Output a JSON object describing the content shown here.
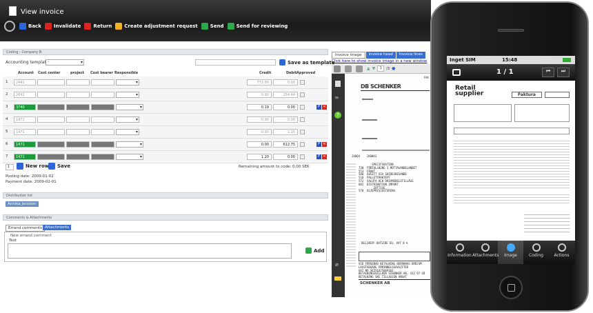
{
  "header": {
    "title": "View invoice",
    "toolbar": [
      {
        "label": "Back",
        "icon": "back-icon",
        "color": "#2a66d8"
      },
      {
        "label": "Invalidate",
        "icon": "invalidate-icon",
        "color": "#d22"
      },
      {
        "label": "Return",
        "icon": "return-icon",
        "color": "#d22"
      },
      {
        "label": "Create adjustment request",
        "icon": "folder-icon",
        "color": "#f0b020"
      },
      {
        "label": "Send",
        "icon": "check-icon",
        "color": "#2aa84a"
      },
      {
        "label": "Send for reviewing",
        "icon": "check-icon",
        "color": "#2aa84a"
      }
    ]
  },
  "coding": {
    "section_title": "Coding - Company B",
    "templates_label": "Accounting templates",
    "templates_value": "-",
    "save_template": "Save as template",
    "columns": [
      "Account",
      "Cost center",
      "project",
      "Cost bearer",
      "Responsible",
      "Credit",
      "Debit",
      "Approved"
    ],
    "rows": [
      {
        "n": "1",
        "account": "2441",
        "credit": "772.00",
        "debit": "0.00",
        "active": false,
        "green": false
      },
      {
        "n": "2",
        "account": "2641",
        "credit": "0.00",
        "debit": "154.44",
        "active": false,
        "green": false
      },
      {
        "n": "3",
        "account": "3740",
        "credit": "0.19",
        "debit": "0.00",
        "active": true,
        "green": true
      },
      {
        "n": "4",
        "account": "1471",
        "credit": "0.00",
        "debit": "0.00",
        "active": false,
        "green": false
      },
      {
        "n": "5",
        "account": "1471",
        "credit": "0.00",
        "debit": "1.25",
        "active": false,
        "green": false
      },
      {
        "n": "6",
        "account": "1471",
        "credit": "0.00",
        "debit": "612.75",
        "active": true,
        "green": true
      },
      {
        "n": "7",
        "account": "1471",
        "credit": "1.20",
        "debit": "0.00",
        "active": true,
        "green": true
      }
    ],
    "new_row_count": "1",
    "new_row": "New row",
    "save": "Save",
    "remaining": "Remaining amount to code:  0.00 SEK",
    "posting_date": "Posting date: 2009-01-02",
    "payment_date": "Payment date: 2009-02-01"
  },
  "distribution": {
    "title": "Distribution list",
    "person": "Annika Jansson"
  },
  "comments": {
    "title": "Comments & Attachments",
    "tab_comments": "Errand comments",
    "tab_attachments": "Attachments",
    "legend": "New errand comment",
    "text_label": "Text",
    "add": "Add"
  },
  "viewer": {
    "tabs": [
      "Invoice image",
      "Invoice head",
      "Invoice lines"
    ],
    "link": "Click here to show invoice image in a new window",
    "page": "1",
    "pages": "/3",
    "company": "DB SCHENKER",
    "footer_company": "SCHENKER AB",
    "page_label": "FAK",
    "codes": "JX064    JX0043",
    "body": "        SPECIFIKATION\n730  FÖRTULLNING I MOTTAGANDELANDET\n553  FRAKT\n580  AVGIFT VIA SKIDESRESANDE\n510  PALLETFRAKTEPT\n572  VALUTA OCH DRIVMEDELSTILLÄGG\n602  DISTRIBUTION IMPORT\n         ZOTTIGE\n570  OLJEPRISJUSTERING",
    "delivery": "DELIVERY OUTSIDE EU, VAT 0 %",
    "notes": "VID FÖRSENAD BETALNING BERÄKNAS DRÖJSM\nLAGSTADGADE PÅMINNELSEAVGIFTER\nVAT NO SE556325069101\nBETALNINGSVILLKOR SCHENKER AB, 412 97 GÖ\nBETALNING SKE TILLAGSEN ANGAT"
  },
  "phone": {
    "carrier": "Inget SIM",
    "time": "15:48",
    "page": "1 / 1",
    "retail": "Retail",
    "supplier": "supplier",
    "doc_type": "Faktura",
    "tabs": [
      "Information",
      "Attachments",
      "Image",
      "Coding",
      "Actions"
    ]
  }
}
